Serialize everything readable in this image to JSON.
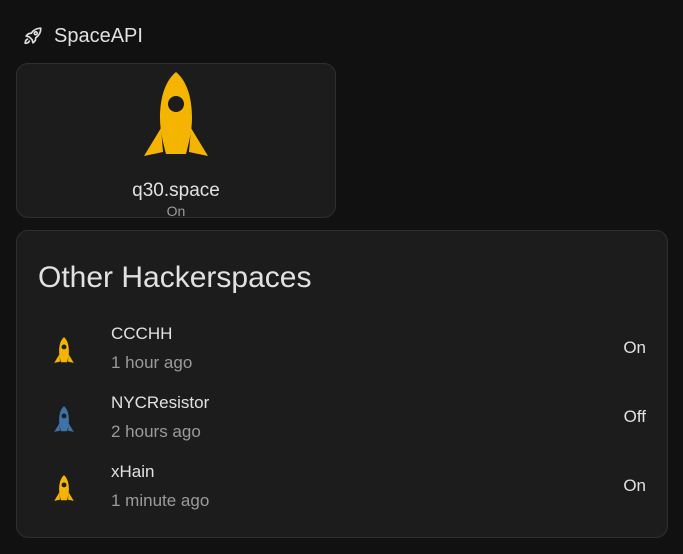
{
  "header": {
    "icon": "rocket-launch-icon",
    "title": "SpaceAPI"
  },
  "main_entity": {
    "icon": "rocket-icon",
    "icon_color": "#f4b400",
    "name": "q30.space",
    "state": "On"
  },
  "other": {
    "title": "Other Hackerspaces",
    "items": [
      {
        "icon": "rocket-icon",
        "icon_color": "#f4b400",
        "name": "CCCHH",
        "time": "1 hour ago",
        "state": "On"
      },
      {
        "icon": "rocket-icon",
        "icon_color": "#3d73a8",
        "name": "NYCResistor",
        "time": "2 hours ago",
        "state": "Off"
      },
      {
        "icon": "rocket-icon",
        "icon_color": "#f4b400",
        "name": "xHain",
        "time": "1 minute ago",
        "state": "On"
      }
    ]
  }
}
